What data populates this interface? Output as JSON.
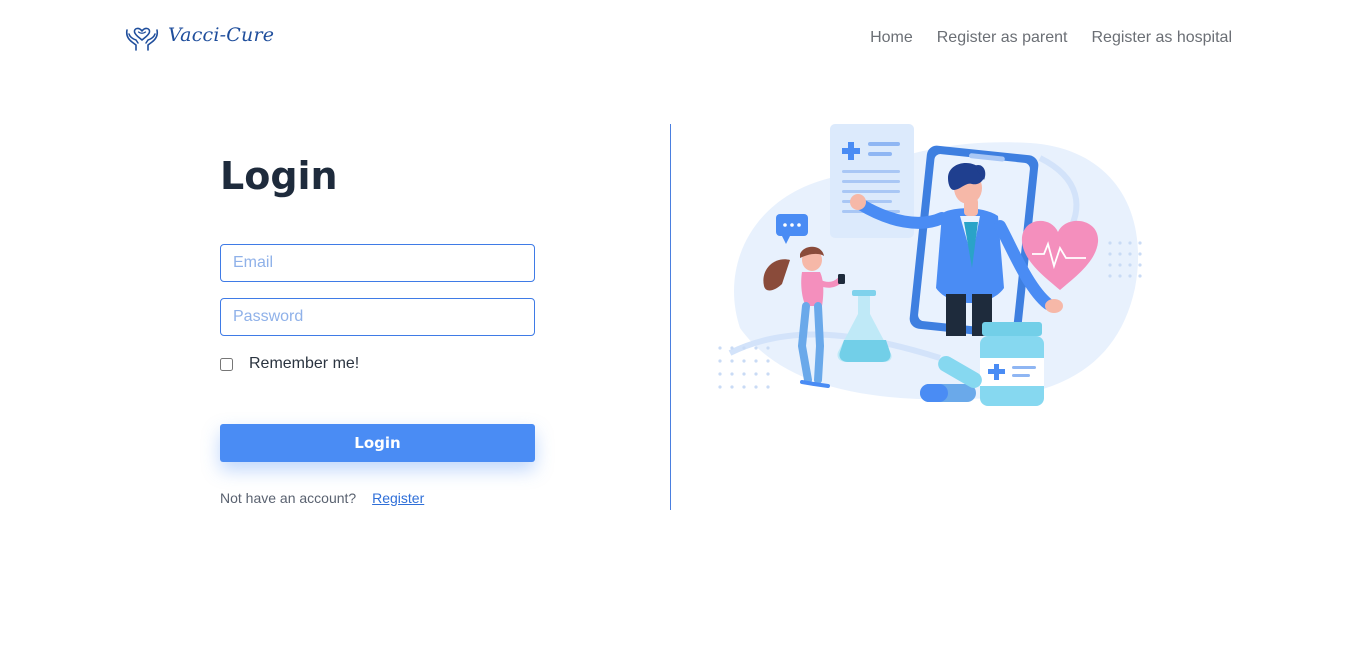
{
  "header": {
    "brand_name": "Vacci-Cure",
    "brand_icon": "hands-heart-icon",
    "nav": [
      {
        "label": "Home"
      },
      {
        "label": "Register as parent"
      },
      {
        "label": "Register as hospital"
      }
    ]
  },
  "login": {
    "title": "Login",
    "email_placeholder": "Email",
    "email_value": "",
    "password_placeholder": "Password",
    "password_value": "",
    "remember_label": "Remember me!",
    "remember_checked": false,
    "submit_label": "Login",
    "no_account_text": "Not have an account?",
    "register_link": "Register"
  },
  "illustration": {
    "description_icon": "doctor-telemedicine-illustration"
  },
  "colors": {
    "accent": "#4a8cf4",
    "brand": "#1f4e9c",
    "border": "#3f7be6",
    "divider": "#4a7fe0"
  }
}
